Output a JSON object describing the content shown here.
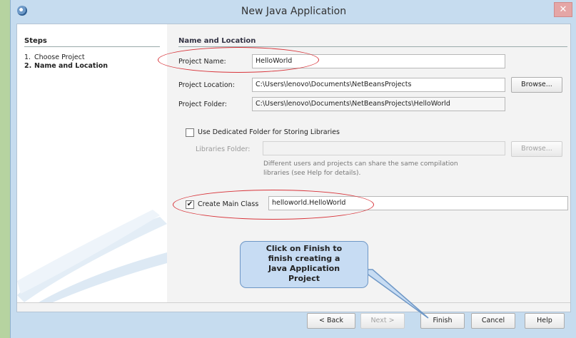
{
  "window": {
    "title": "New Java Application",
    "close_glyph": "✕"
  },
  "steps": {
    "title": "Steps",
    "items": [
      {
        "num": "1.",
        "label": "Choose Project"
      },
      {
        "num": "2.",
        "label": "Name and Location"
      }
    ]
  },
  "form": {
    "section_title": "Name and Location",
    "project_name_label": "Project Name:",
    "project_name_value": "HelloWorld",
    "project_location_label": "Project Location:",
    "project_location_value": "C:\\Users\\lenovo\\Documents\\NetBeansProjects",
    "browse_label": "Browse...",
    "project_folder_label": "Project Folder:",
    "project_folder_value": "C:\\Users\\lenovo\\Documents\\NetBeansProjects\\HelloWorld",
    "dedicated_folder_label": "Use Dedicated Folder for Storing Libraries",
    "dedicated_folder_checked": false,
    "libraries_folder_label": "Libraries Folder:",
    "libraries_folder_value": "",
    "browse_disabled_label": "Browse...",
    "note_line1": "Different users and projects can share the same compilation",
    "note_line2": "libraries (see Help for details).",
    "create_main_label": "Create Main Class",
    "create_main_checked": true,
    "check_glyph": "✔",
    "main_class_value": "helloworld.HelloWorld"
  },
  "callout": {
    "lines": [
      "Click on Finish to",
      "finish creating a",
      "Java Application",
      "Project"
    ]
  },
  "buttons": {
    "back": "< Back",
    "next": "Next >",
    "finish": "Finish",
    "cancel": "Cancel",
    "help": "Help"
  },
  "colors": {
    "annotation_red": "#d8343a",
    "callout_fill": "#c7dcf3",
    "window_chrome": "#c6dcef"
  }
}
